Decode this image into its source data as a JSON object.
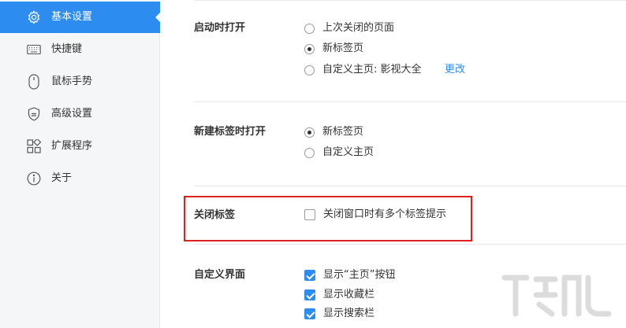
{
  "sidebar": {
    "items": [
      {
        "label": "基本设置",
        "icon": "gear-icon",
        "active": true
      },
      {
        "label": "快捷键",
        "icon": "keyboard-icon",
        "active": false
      },
      {
        "label": "鼠标手势",
        "icon": "mouse-icon",
        "active": false
      },
      {
        "label": "高级设置",
        "icon": "shield-icon",
        "active": false
      },
      {
        "label": "扩展程序",
        "icon": "extensions-icon",
        "active": false
      },
      {
        "label": "关于",
        "icon": "info-icon",
        "active": false
      }
    ]
  },
  "startup": {
    "title": "启动时打开",
    "options": [
      {
        "label": "上次关闭的页面",
        "checked": false
      },
      {
        "label": "新标签页",
        "checked": true
      },
      {
        "label": "自定义主页: 影视大全",
        "checked": false
      }
    ],
    "change_link": "更改"
  },
  "newtab": {
    "title": "新建标签时打开",
    "options": [
      {
        "label": "新标签页",
        "checked": true
      },
      {
        "label": "自定义主页",
        "checked": false
      }
    ]
  },
  "closetab": {
    "title": "关闭标签",
    "option": {
      "label": "关闭窗口时有多个标签提示",
      "checked": false
    }
  },
  "ui": {
    "title": "自定义界面",
    "options": [
      {
        "label": "显示“主页”按钮",
        "checked": true
      },
      {
        "label": "显示收藏栏",
        "checked": true
      },
      {
        "label": "显示搜索栏",
        "checked": true
      }
    ]
  },
  "colors": {
    "accent": "#2d8cf0",
    "highlight": "#e02020",
    "sidebar_bg": "#f5f6f7"
  }
}
